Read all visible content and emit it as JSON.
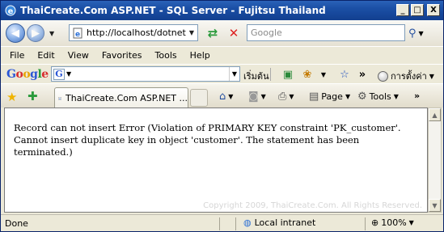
{
  "window": {
    "title": "ThaiCreate.Com ASP.NET - SQL Server - Fujitsu Thailand",
    "minimize": "_",
    "maximize": "□",
    "close": "X"
  },
  "address_bar": {
    "url": "http://localhost/dotnet/As",
    "search_placeholder": "Google"
  },
  "menu": [
    "File",
    "Edit",
    "View",
    "Favorites",
    "Tools",
    "Help"
  ],
  "google_toolbar": {
    "logo": [
      "G",
      "o",
      "o",
      "g",
      "l",
      "e"
    ],
    "badge": "G",
    "start_label": "เริ่มต้น",
    "more": "»",
    "settings_label": "การตั้งค่า"
  },
  "tabs": [
    {
      "label": "ThaiCreate.Com ASP.NET ..."
    }
  ],
  "command_bar": {
    "more": "»",
    "page_label": "Page",
    "tools_label": "Tools"
  },
  "content": {
    "message": "Record can not insert Error (Violation of PRIMARY KEY constraint 'PK_customer'. Cannot insert duplicate key in object 'customer'. The statement has been terminated.)",
    "watermark": "Copyright 2009, ThaiCreate.Com. All Rights Reserved."
  },
  "status": {
    "text": "Done",
    "zone": "Local intranet",
    "zoom": "100%"
  },
  "colors": {
    "title_bar": "#1b4fa5",
    "chrome": "#ece9d8",
    "content_bg": "#ffffff"
  }
}
